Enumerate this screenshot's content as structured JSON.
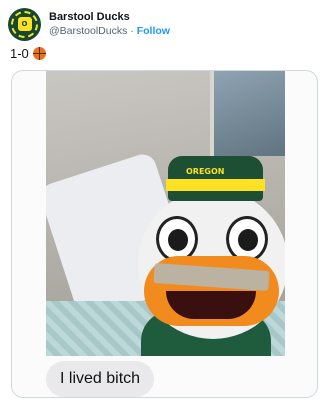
{
  "account": {
    "display_name": "Barstool Ducks",
    "handle": "@BarstoolDucks",
    "separator": "·",
    "follow_label": "Follow"
  },
  "tweet": {
    "text": "1-0",
    "emoji": "basketball-icon"
  },
  "media": {
    "hat_text": "OREGON",
    "message_text": "I lived bitch"
  },
  "colors": {
    "brand_green": "#154733",
    "brand_yellow": "#fee123",
    "link_blue": "#1d9bf0"
  }
}
